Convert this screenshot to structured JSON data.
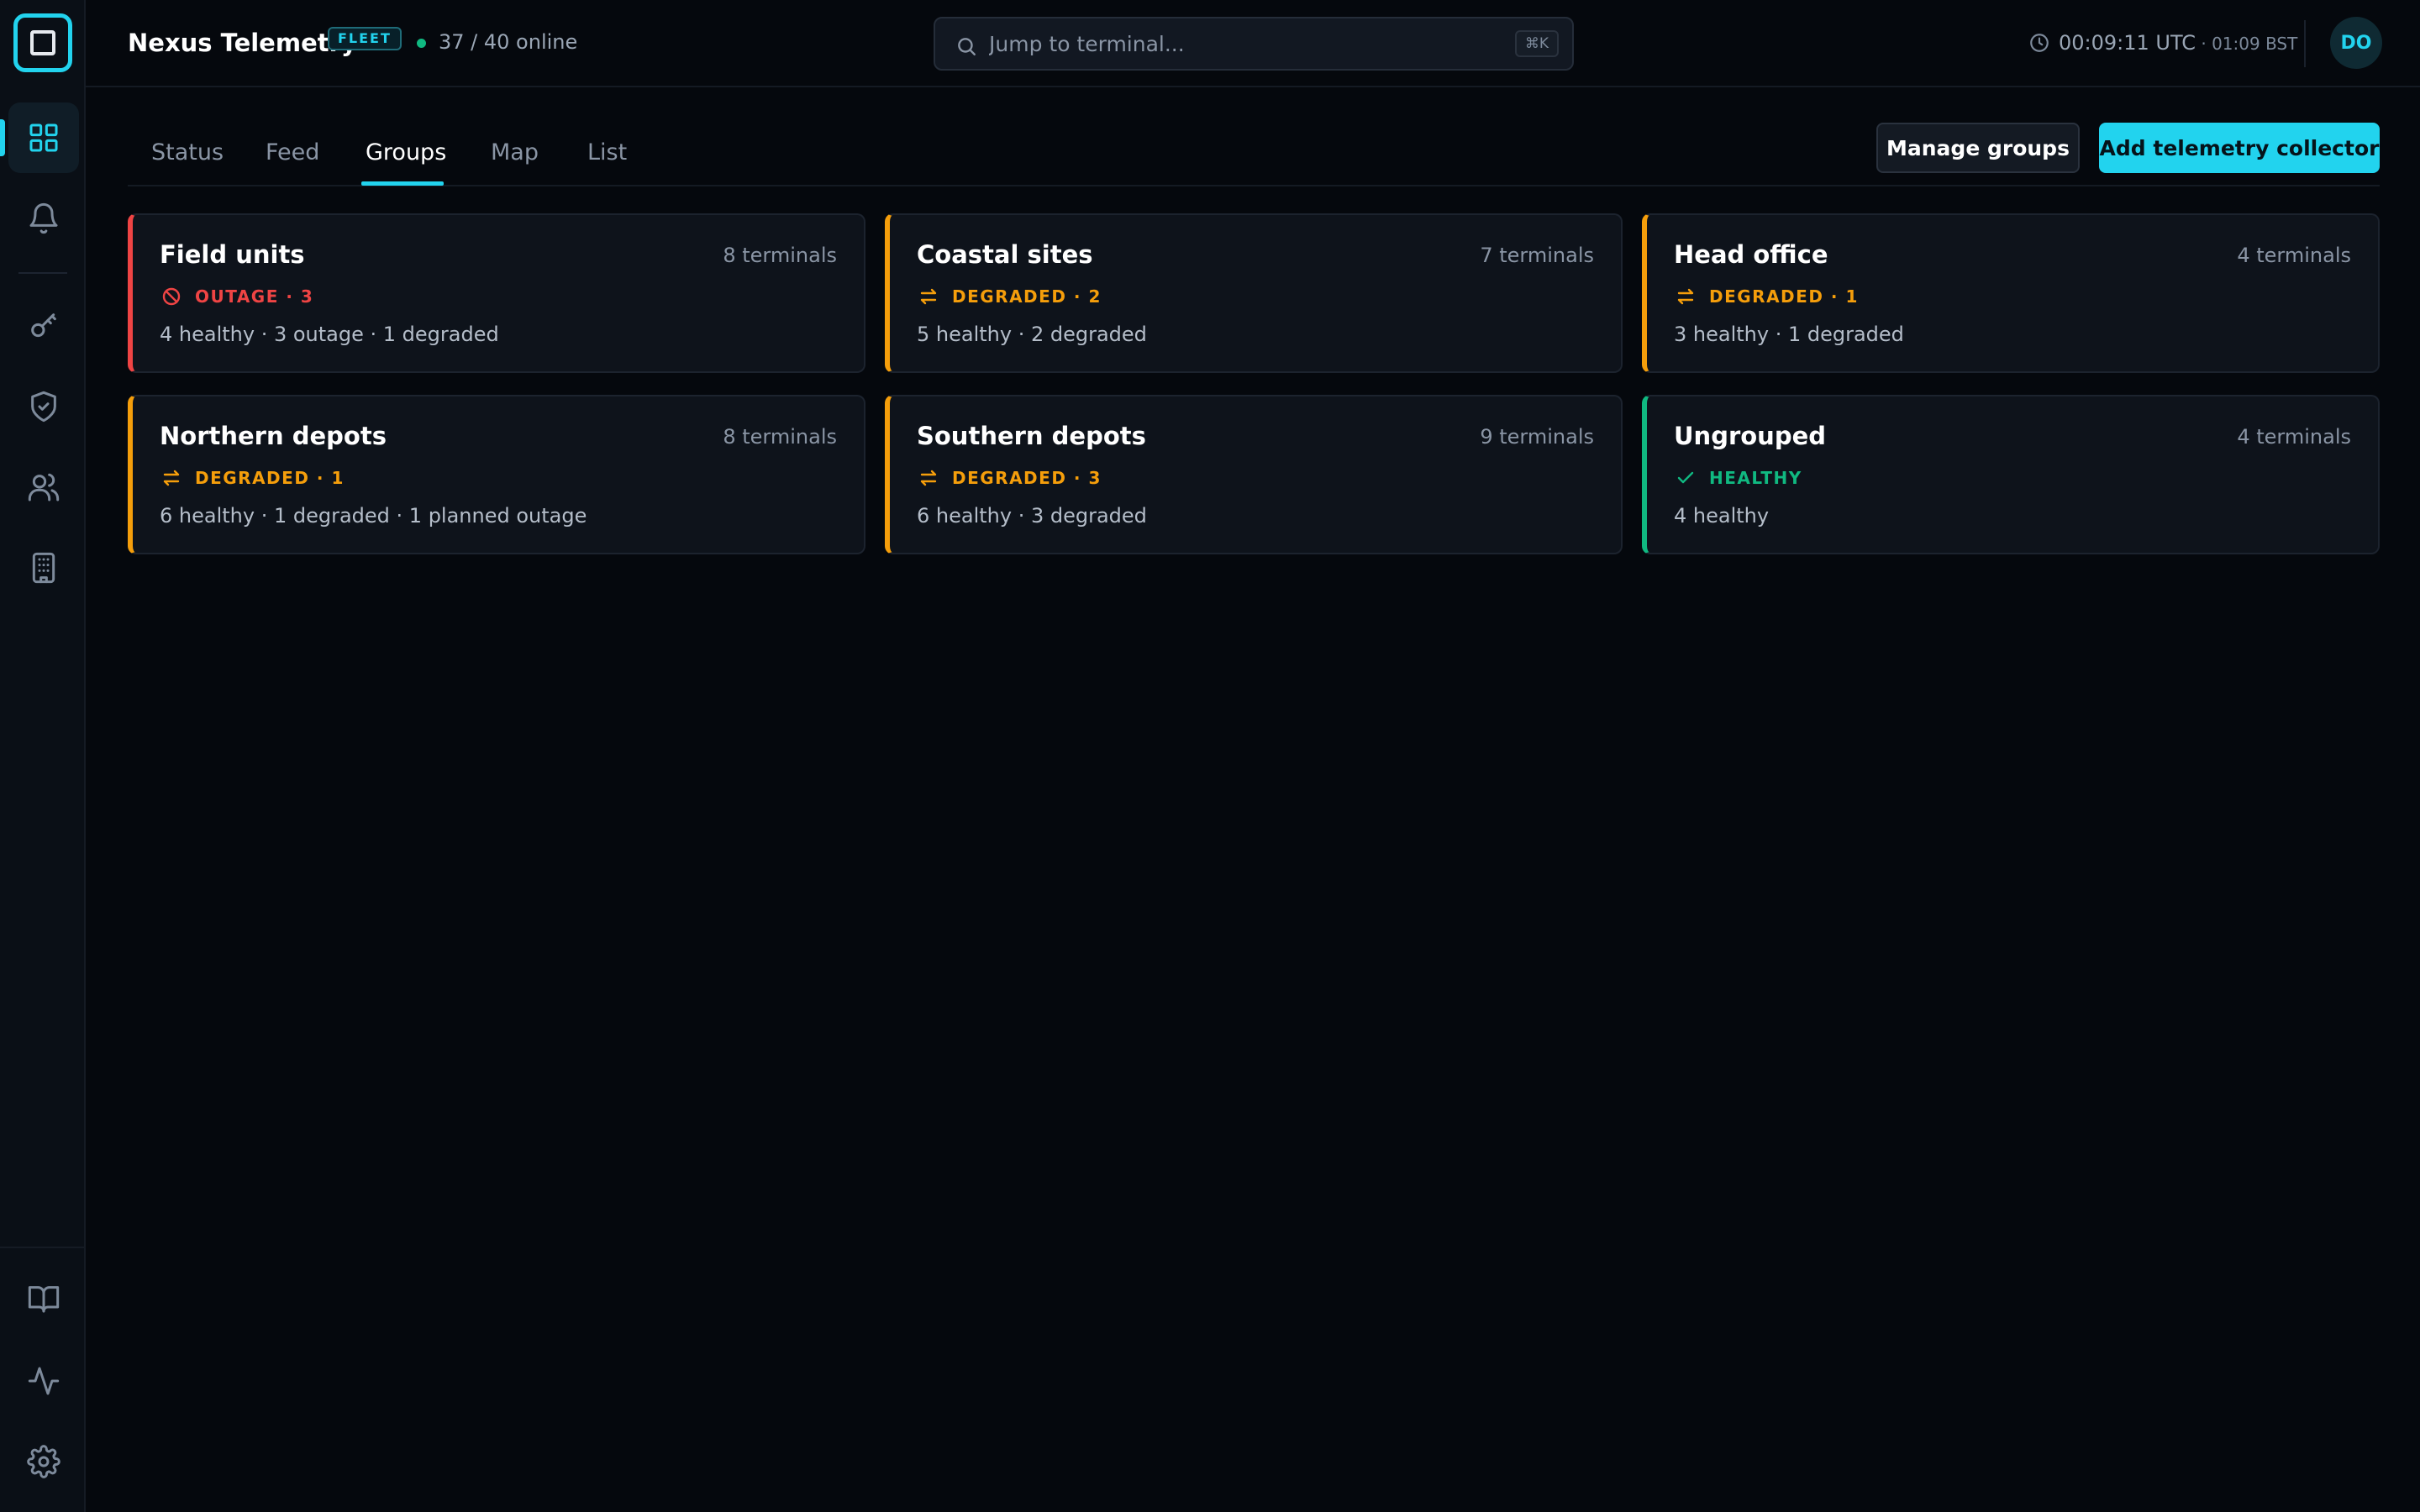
{
  "header": {
    "app_title": "Nexus Telemetry",
    "badge": "FLEET",
    "online_status": "37 / 40 online",
    "search_placeholder": "Jump to terminal...",
    "search_shortcut": "⌘K",
    "clock_utc": "00:09:11 UTC",
    "clock_local": " · 01:09 BST",
    "avatar_initials": "DO"
  },
  "sidebar": {
    "items": [
      {
        "name": "dashboard-icon",
        "active": true
      },
      {
        "name": "bell-icon",
        "active": false
      },
      {
        "name": "key-icon",
        "active": false
      },
      {
        "name": "shield-icon",
        "active": false
      },
      {
        "name": "users-icon",
        "active": false
      },
      {
        "name": "building-icon",
        "active": false
      }
    ],
    "bottom_items": [
      {
        "name": "book-icon"
      },
      {
        "name": "activity-icon"
      },
      {
        "name": "gear-icon"
      }
    ]
  },
  "tabs": [
    {
      "label": "Status",
      "active": false
    },
    {
      "label": "Feed",
      "active": false
    },
    {
      "label": "Groups",
      "active": true
    },
    {
      "label": "Map",
      "active": false
    },
    {
      "label": "List",
      "active": false
    }
  ],
  "actions": {
    "manage_groups": "Manage groups",
    "add_collector": "Add telemetry collector"
  },
  "groups": [
    {
      "title": "Field units",
      "count": "8 terminals",
      "status": "OUTAGE · 3",
      "status_type": "outage",
      "summary": "4 healthy · 3 outage · 1 degraded"
    },
    {
      "title": "Coastal sites",
      "count": "7 terminals",
      "status": "DEGRADED · 2",
      "status_type": "degraded",
      "summary": "5 healthy · 2 degraded"
    },
    {
      "title": "Head office",
      "count": "4 terminals",
      "status": "DEGRADED · 1",
      "status_type": "degraded",
      "summary": "3 healthy · 1 degraded"
    },
    {
      "title": "Northern depots",
      "count": "8 terminals",
      "status": "DEGRADED · 1",
      "status_type": "degraded",
      "summary": "6 healthy · 1 degraded · 1 planned outage"
    },
    {
      "title": "Southern depots",
      "count": "9 terminals",
      "status": "DEGRADED · 3",
      "status_type": "degraded",
      "summary": "6 healthy · 3 degraded"
    },
    {
      "title": "Ungrouped",
      "count": "4 terminals",
      "status": "HEALTHY",
      "status_type": "healthy",
      "summary": "4 healthy"
    }
  ],
  "colors": {
    "accent": "#22d3ee",
    "outage": "#ef4444",
    "degraded": "#f59e0b",
    "healthy": "#10b981",
    "background": "#05080d"
  }
}
